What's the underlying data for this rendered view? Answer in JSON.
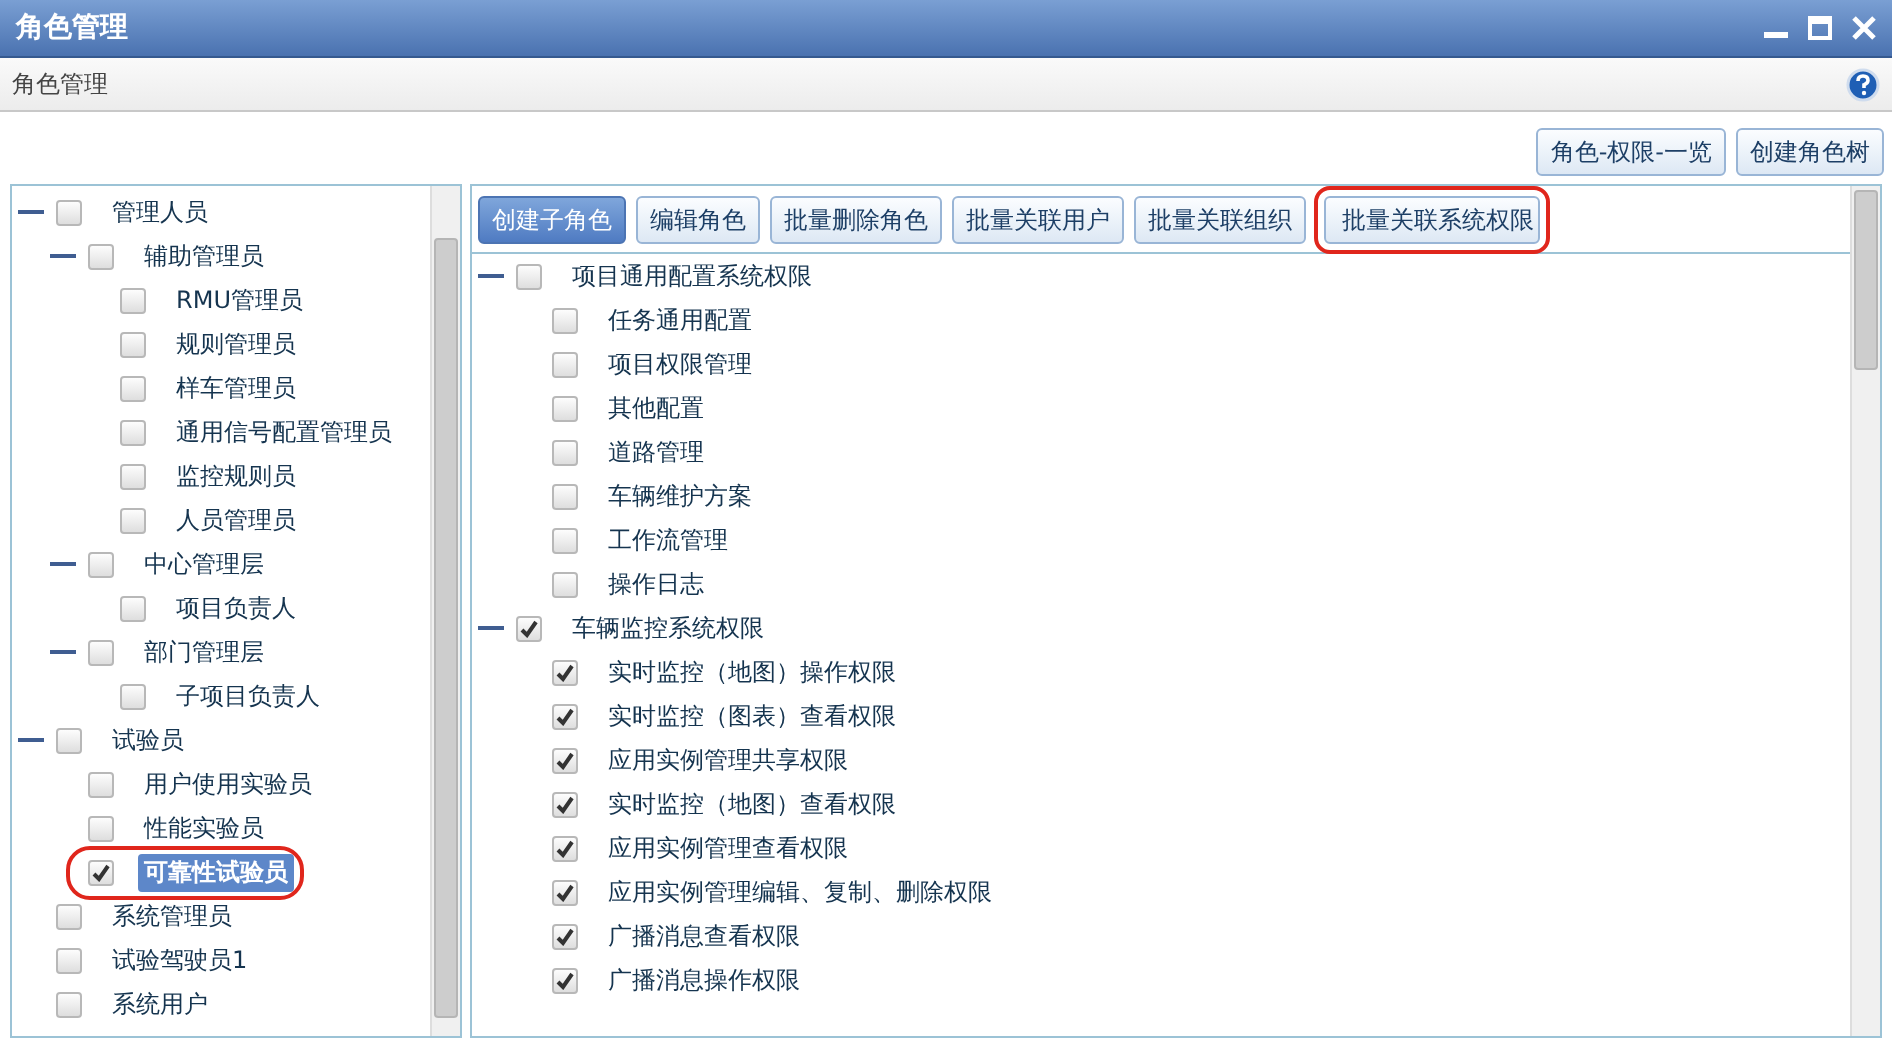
{
  "window": {
    "title": "角色管理"
  },
  "header": {
    "title": "角色管理"
  },
  "top_buttons": [
    "角色-权限-一览",
    "创建角色树"
  ],
  "role_tree": [
    {
      "label": "管理人员",
      "checked": false,
      "expanded": true,
      "selected": false,
      "annotated": false,
      "children": [
        {
          "label": "辅助管理员",
          "checked": false,
          "expanded": true,
          "selected": false,
          "annotated": false,
          "children": [
            {
              "label": "RMU管理员",
              "checked": false,
              "selected": false,
              "annotated": false
            },
            {
              "label": "规则管理员",
              "checked": false,
              "selected": false,
              "annotated": false
            },
            {
              "label": "样车管理员",
              "checked": false,
              "selected": false,
              "annotated": false
            },
            {
              "label": "通用信号配置管理员",
              "checked": false,
              "selected": false,
              "annotated": false
            },
            {
              "label": "监控规则员",
              "checked": false,
              "selected": false,
              "annotated": false
            },
            {
              "label": "人员管理员",
              "checked": false,
              "selected": false,
              "annotated": false
            }
          ]
        },
        {
          "label": "中心管理层",
          "checked": false,
          "expanded": true,
          "selected": false,
          "annotated": false,
          "children": [
            {
              "label": "项目负责人",
              "checked": false,
              "selected": false,
              "annotated": false
            }
          ]
        },
        {
          "label": "部门管理层",
          "checked": false,
          "expanded": true,
          "selected": false,
          "annotated": false,
          "children": [
            {
              "label": "子项目负责人",
              "checked": false,
              "selected": false,
              "annotated": false
            }
          ]
        }
      ]
    },
    {
      "label": "试验员",
      "checked": false,
      "expanded": true,
      "selected": false,
      "annotated": false,
      "children": [
        {
          "label": "用户使用实验员",
          "checked": false,
          "selected": false,
          "annotated": false
        },
        {
          "label": "性能实验员",
          "checked": false,
          "selected": false,
          "annotated": false
        },
        {
          "label": "可靠性试验员",
          "checked": true,
          "selected": true,
          "annotated": true
        }
      ]
    },
    {
      "label": "系统管理员",
      "checked": false,
      "selected": false,
      "annotated": false
    },
    {
      "label": "试验驾驶员1",
      "checked": false,
      "selected": false,
      "annotated": false
    },
    {
      "label": "系统用户",
      "checked": false,
      "selected": false,
      "annotated": false
    }
  ],
  "toolbar": [
    {
      "label": "创建子角色",
      "kind": "primary",
      "annotated": false
    },
    {
      "label": "编辑角色",
      "kind": "default",
      "annotated": false
    },
    {
      "label": "批量删除角色",
      "kind": "default",
      "annotated": false
    },
    {
      "label": "批量关联用户",
      "kind": "default",
      "annotated": false
    },
    {
      "label": "批量关联组织",
      "kind": "default",
      "annotated": false
    },
    {
      "label": "批量关联系统权限",
      "kind": "default",
      "annotated": true
    }
  ],
  "permission_tree": [
    {
      "label": "项目通用配置系统权限",
      "checked": false,
      "expanded": true,
      "children": [
        {
          "label": "任务通用配置",
          "checked": false
        },
        {
          "label": "项目权限管理",
          "checked": false
        },
        {
          "label": "其他配置",
          "checked": false
        },
        {
          "label": "道路管理",
          "checked": false
        },
        {
          "label": "车辆维护方案",
          "checked": false
        },
        {
          "label": "工作流管理",
          "checked": false
        },
        {
          "label": "操作日志",
          "checked": false
        }
      ]
    },
    {
      "label": "车辆监控系统权限",
      "checked": true,
      "expanded": true,
      "children": [
        {
          "label": "实时监控（地图）操作权限",
          "checked": true
        },
        {
          "label": "实时监控（图表）查看权限",
          "checked": true
        },
        {
          "label": "应用实例管理共享权限",
          "checked": true
        },
        {
          "label": "实时监控（地图）查看权限",
          "checked": true
        },
        {
          "label": "应用实例管理查看权限",
          "checked": true
        },
        {
          "label": "应用实例管理编辑、复制、删除权限",
          "checked": true
        },
        {
          "label": "广播消息查看权限",
          "checked": true
        },
        {
          "label": "广播消息操作权限",
          "checked": true
        }
      ]
    }
  ]
}
